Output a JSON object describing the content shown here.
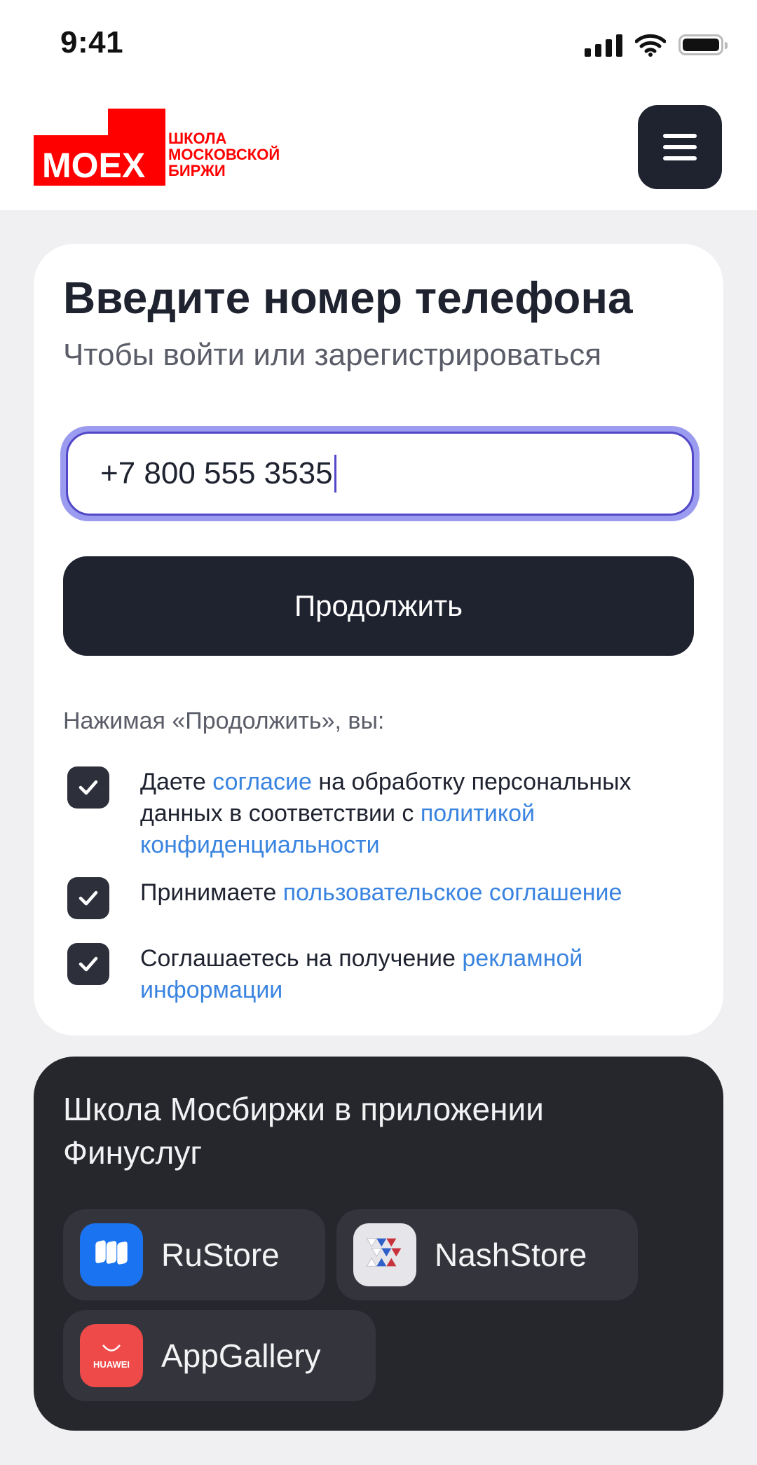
{
  "status_bar": {
    "time": "9:41"
  },
  "header": {
    "logo_mark": "MOEX",
    "logo_lines": [
      "ШКОЛА",
      "МОСКОВСКОЙ",
      "БИРЖИ"
    ],
    "brand_color": "#ff0000"
  },
  "auth": {
    "title": "Введите номер телефона",
    "subtitle": "Чтобы войти или зарегистрироваться",
    "phone_value": "+7 800 555 3535",
    "continue_label": "Продолжить",
    "consent_intro": "Нажимая «Продолжить», вы:",
    "consents": [
      {
        "checked": true,
        "pre": "Даете ",
        "link1": "согласие",
        "mid": " на обработку персональных данных в соответствии с ",
        "link2": "политикой конфиденциальности"
      },
      {
        "checked": true,
        "pre": "Принимаете ",
        "link1": "пользовательское соглашение"
      },
      {
        "checked": true,
        "pre": "Соглашаетесь на получение ",
        "link1": "рекламной информации"
      }
    ],
    "link_color": "#3a84e0"
  },
  "apps": {
    "title": "Школа Мосбиржи в приложении Финуслуг",
    "stores": [
      {
        "label": "RuStore",
        "icon": "rustore-icon"
      },
      {
        "label": "NashStore",
        "icon": "nashstore-icon"
      },
      {
        "label": "AppGallery",
        "icon": "appgallery-icon",
        "icon_text": "HUAWEI"
      }
    ]
  }
}
